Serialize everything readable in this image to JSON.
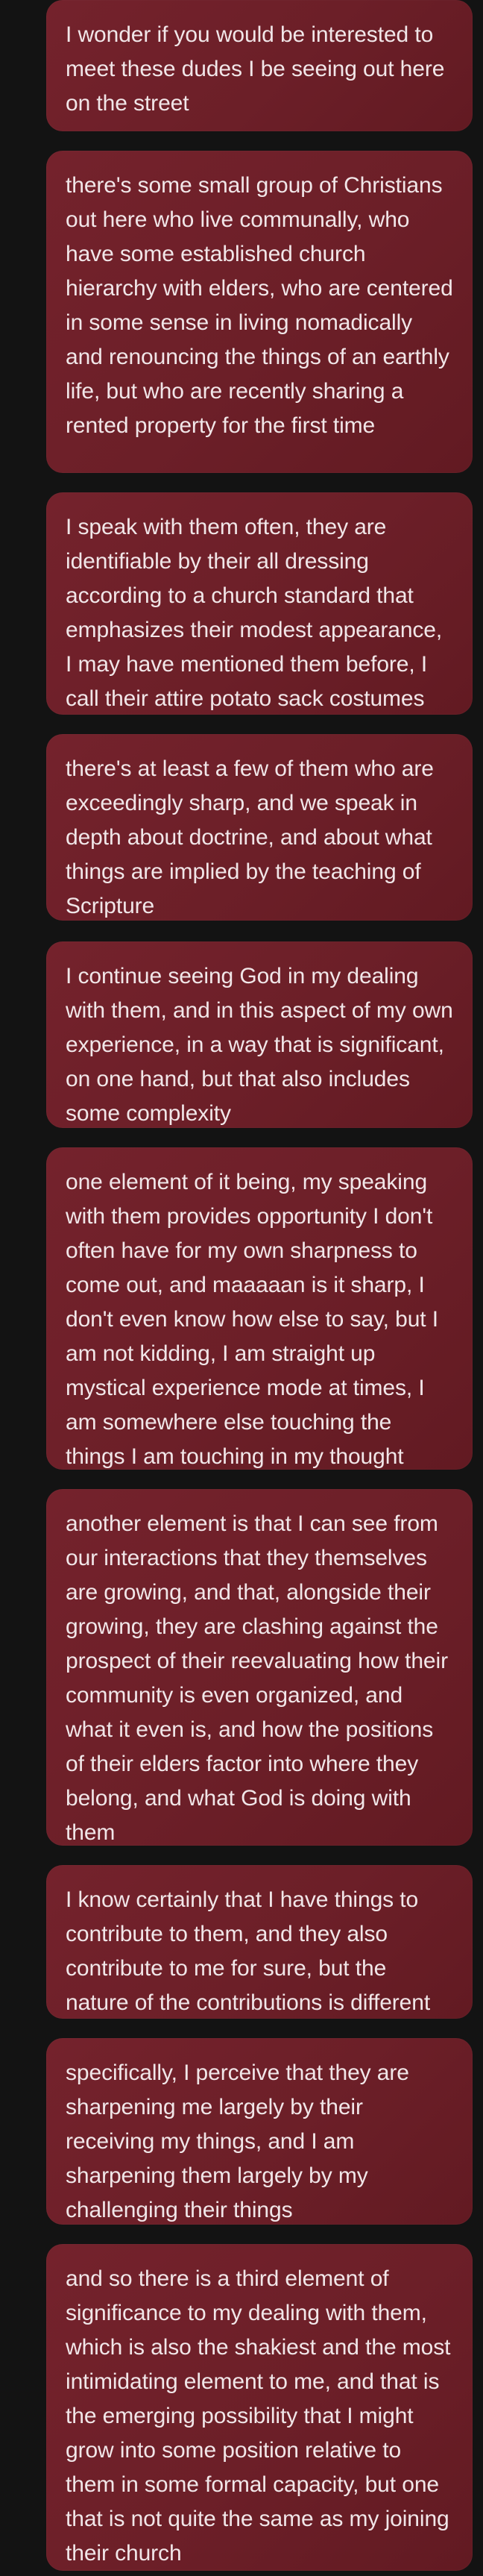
{
  "messages": [
    {
      "text": "I wonder if you would be interested to meet these dudes I be seeing out here on the street"
    },
    {
      "text": "there's some small group of Christians out here who live communally, who have some established church hierarchy with elders, who are centered in some sense in living nomadically and renouncing the things of an earthly life, but who are recently sharing a rented property for the first time"
    },
    {
      "text": "I speak with them often, they are identifiable by their all dressing according to a church standard that emphasizes their modest appearance, I may have mentioned them before, I call their attire potato sack costumes"
    },
    {
      "text": "there's at least a few of them who are exceedingly sharp, and we speak in depth about doctrine, and about what things are implied by the teaching of Scripture"
    },
    {
      "text": "I continue seeing God in my dealing with them, and in this aspect of my own experience, in a way that is significant, on one hand, but that also includes some complexity"
    },
    {
      "text": "one element of it being, my speaking with them provides opportunity I don't often have for my own sharpness to come out, and maaaaan is it sharp, I don't even know how else to say, but I am not kidding, I am straight up mystical experience mode at times, I am somewhere else touching the things I am touching in my thought"
    },
    {
      "text": "another element is that I can see from our interactions that they themselves are growing, and that, alongside their growing, they are clashing against the prospect of their reevaluating how their community is even organized, and what it even is, and how the positions of their elders factor into where they belong, and what God is doing with them"
    },
    {
      "text": "I know certainly that I have things to contribute to them, and they also contribute to me for sure, but the nature of the contributions is different"
    },
    {
      "text": "specifically, I perceive that they are sharpening me largely by their receiving my things, and I am sharpening them largely by my challenging their things"
    },
    {
      "text": "and so there is a third element of significance to my dealing with them, which is also the shakiest and the most intimidating element to me, and that is the emerging possibility that I might grow into some position relative to them in some formal capacity, but one that is not quite the same as my joining their church"
    }
  ]
}
